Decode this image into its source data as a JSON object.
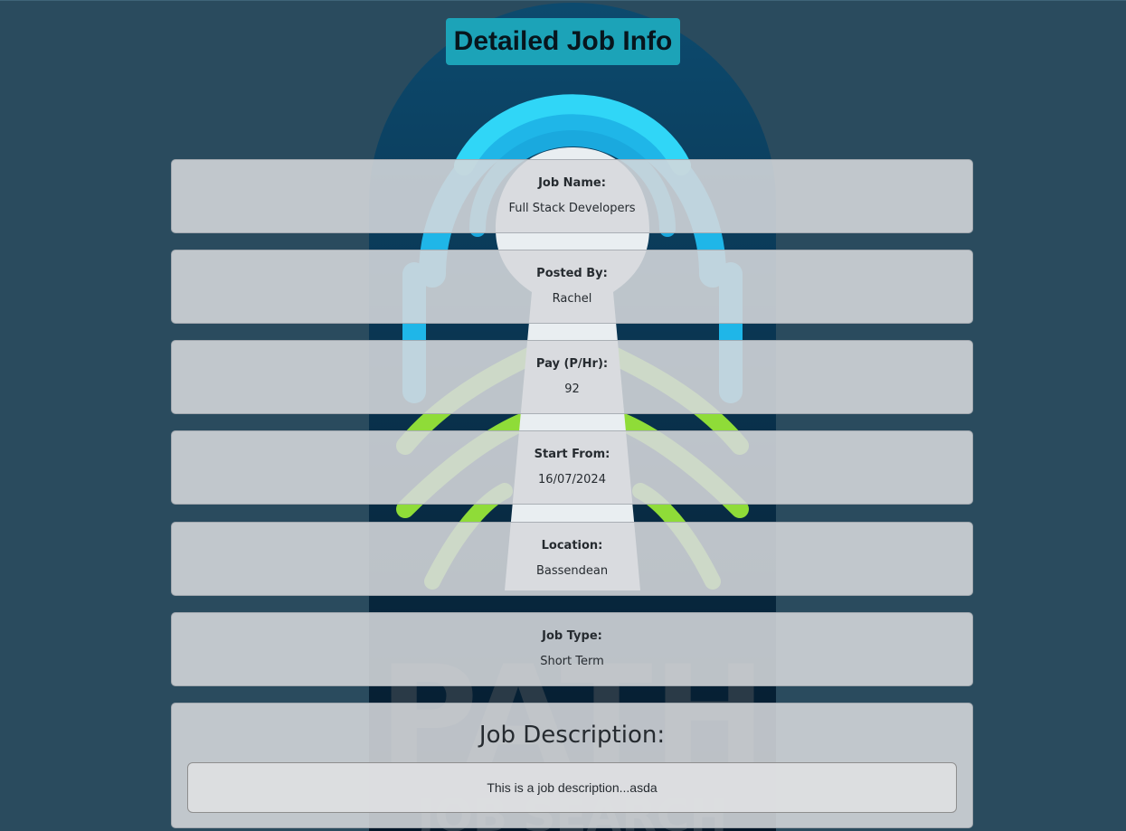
{
  "page": {
    "title": "Detailed Job Info"
  },
  "fields": [
    {
      "label": "Job Name:",
      "value": "Full Stack Developers"
    },
    {
      "label": "Posted By:",
      "value": "Rachel"
    },
    {
      "label": "Pay (P/Hr):",
      "value": "92"
    },
    {
      "label": "Start From:",
      "value": "16/07/2024"
    },
    {
      "label": "Location:",
      "value": "Bassendean"
    },
    {
      "label": "Job Type:",
      "value": "Short Term"
    }
  ],
  "description": {
    "heading": "Job Description:",
    "text": "This is a job description...asda"
  },
  "background_logo": {
    "wordmark": "PATH",
    "subtitle": "JOB SEARCH",
    "icon": "fingerprint-icon"
  },
  "colors": {
    "page_background": "#2a4b5e",
    "title_background": "#1ca3b8",
    "card_background": "#d6d8dc",
    "logo_cyan": "#2ad0f2",
    "logo_green": "#9ee23a"
  }
}
